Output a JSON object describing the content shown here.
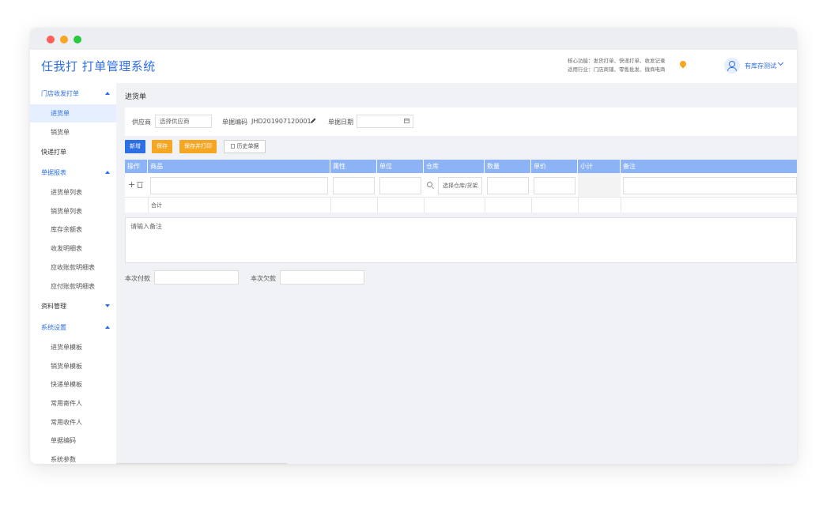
{
  "window": {
    "controls": [
      {
        "name": "close",
        "color": "#ff5f57"
      },
      {
        "name": "minimize",
        "color": "#f5a623"
      },
      {
        "name": "maximize",
        "color": "#28c840"
      }
    ]
  },
  "header": {
    "app_title": "任我打 打单管理系统",
    "core_functions": "核心功能：发货打单、快递打单、收发记录",
    "industries": "适用行业：门店商铺、零售批发、微商电商",
    "user_name": "有库存测试"
  },
  "sidebar": {
    "groups": [
      {
        "label": "门店收发打单",
        "expanded": true,
        "items": [
          "进货单",
          "销货单"
        ]
      },
      {
        "label": "快递打单"
      },
      {
        "label": "单据报表",
        "expanded": true,
        "items": [
          "进货单列表",
          "销货单列表",
          "库存余额表",
          "收发明细表",
          "应收账款明细表",
          "应付账款明细表"
        ]
      },
      {
        "label": "资料管理",
        "expanded": false
      },
      {
        "label": "系统设置",
        "expanded": true,
        "items": [
          "进货单模板",
          "销货单模板",
          "快递单模板",
          "常用寄件人",
          "常用收件人",
          "单据编码",
          "系统参数"
        ]
      }
    ],
    "active_item": "进货单"
  },
  "page": {
    "title": "进货单",
    "supplier_label": "供应商",
    "supplier_placeholder": "选择供应商",
    "doc_code_label": "单据编码",
    "doc_code_value": "JHD201907120001",
    "doc_date_label": "单据日期",
    "buttons": {
      "new": "新增",
      "save": "保存",
      "save_print": "保存并打印",
      "history": "历史单据"
    },
    "table": {
      "columns": [
        "操作",
        "商品",
        "属性",
        "单位",
        "仓库",
        "数量",
        "单价",
        "小计",
        "备注"
      ],
      "row": {
        "warehouse_placeholder": "选择仓库/货架"
      },
      "sum_label": "合计"
    },
    "remark_placeholder": "请输入备注",
    "pay_label": "本次付款",
    "owe_label": "本次欠款"
  },
  "colors": {
    "primary": "#2e6fe6",
    "accent": "#f5a623",
    "table_header": "#8cb3f6"
  }
}
